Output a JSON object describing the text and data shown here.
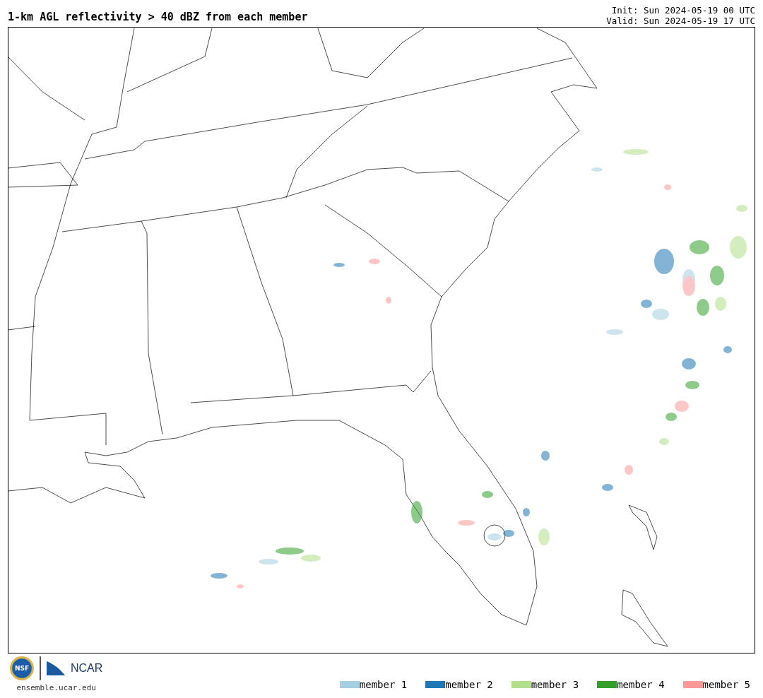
{
  "title": "1-km AGL reflectivity > 40 dBZ from each member",
  "init": "Init: Sun 2024-05-19 00 UTC",
  "valid": "Valid: Sun 2024-05-19 17 UTC",
  "logos": {
    "seal": "NSF",
    "org": "NCAR",
    "url": "ensemble.ucar.edu"
  },
  "legend": [
    {
      "label": "member 1",
      "color": "#a6cee3"
    },
    {
      "label": "member 2",
      "color": "#1f78b4"
    },
    {
      "label": "member 3",
      "color": "#b2df8a"
    },
    {
      "label": "member 4",
      "color": "#33a02c"
    },
    {
      "label": "member 5",
      "color": "#fb9a99"
    }
  ]
}
